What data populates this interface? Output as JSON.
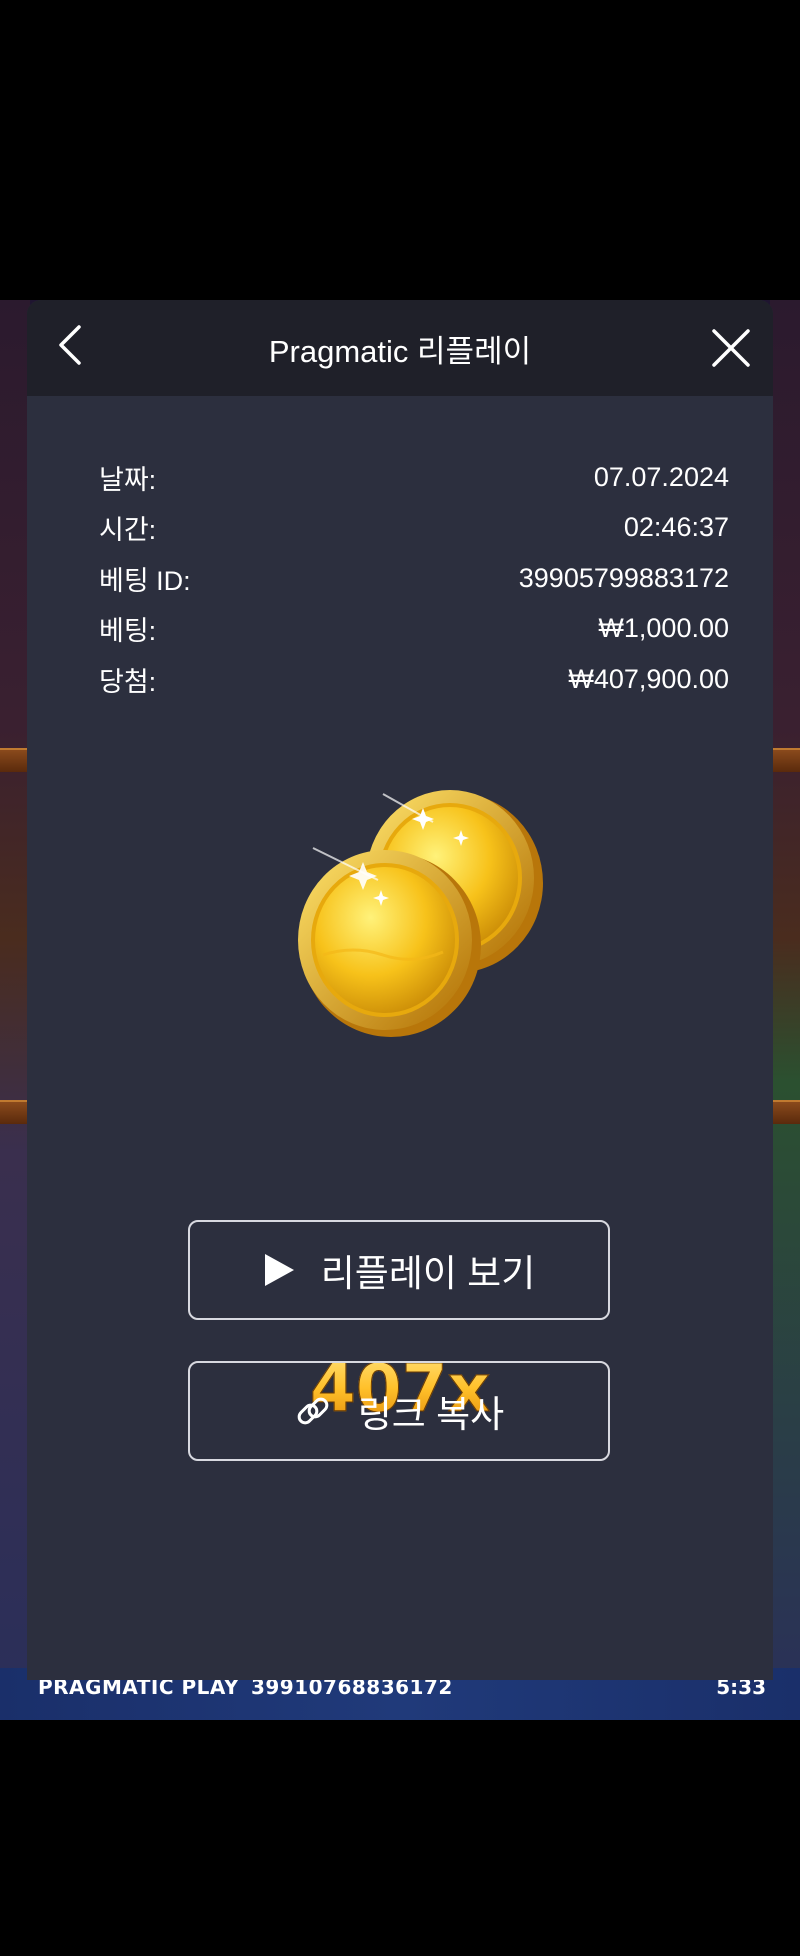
{
  "modal": {
    "title": "Pragmatic 리플레이",
    "back_icon": "chevron-left-icon",
    "close_icon": "close-icon"
  },
  "info": {
    "rows": [
      {
        "label": "날짜:",
        "value": "07.07.2024"
      },
      {
        "label": "시간:",
        "value": "02:46:37"
      },
      {
        "label": "베팅 ID:",
        "value": "39905799883172"
      },
      {
        "label": "베팅:",
        "value": "₩1,000.00"
      },
      {
        "label": "당첨:",
        "value": "₩407,900.00"
      }
    ]
  },
  "win": {
    "icon": "gold-coins-icon",
    "multiplier": "407x"
  },
  "buttons": {
    "replay_label": "리플레이 보기",
    "replay_icon": "play-icon",
    "copy_label": "링크 복사",
    "copy_icon": "link-icon"
  },
  "footer": {
    "brand": "PRAGMATIC PLAY",
    "round_id": "39910768836172",
    "time": "5:33"
  },
  "colors": {
    "modal_bg": "#2c2f3e",
    "header_bg": "#1f2029",
    "gold": "#ffc02a"
  }
}
